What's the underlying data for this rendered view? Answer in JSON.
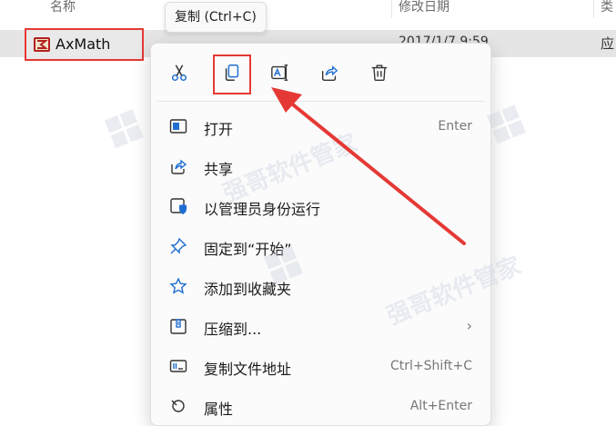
{
  "columns": {
    "name": "名称",
    "date": "修改日期",
    "type": "类"
  },
  "file": {
    "name": "AxMath",
    "date": "2017/1/7 9:59",
    "type": "应"
  },
  "tooltip": "复制 (Ctrl+C)",
  "quick_actions": [
    {
      "name": "cut",
      "icon": "cut-icon"
    },
    {
      "name": "copy",
      "icon": "copy-icon"
    },
    {
      "name": "rename",
      "icon": "rename-icon"
    },
    {
      "name": "share",
      "icon": "share-icon"
    },
    {
      "name": "delete",
      "icon": "delete-icon"
    }
  ],
  "menu_items": [
    {
      "label": "打开",
      "shortcut": "Enter",
      "icon": "open-app-icon"
    },
    {
      "label": "共享",
      "shortcut": "",
      "icon": "share-icon"
    },
    {
      "label": "以管理员身份运行",
      "shortcut": "",
      "icon": "shield-icon"
    },
    {
      "label": "固定到“开始”",
      "shortcut": "",
      "icon": "pin-icon"
    },
    {
      "label": "添加到收藏夹",
      "shortcut": "",
      "icon": "star-icon"
    },
    {
      "label": "压缩到...",
      "shortcut": "",
      "icon": "zip-icon",
      "submenu": true
    },
    {
      "label": "复制文件地址",
      "shortcut": "Ctrl+Shift+C",
      "icon": "path-icon"
    },
    {
      "label": "属性",
      "shortcut": "Alt+Enter",
      "icon": "properties-icon"
    }
  ],
  "watermark": "强哥软件管家",
  "colors": {
    "annotation_red": "#e53935",
    "accent_blue": "#1f6fd1"
  }
}
